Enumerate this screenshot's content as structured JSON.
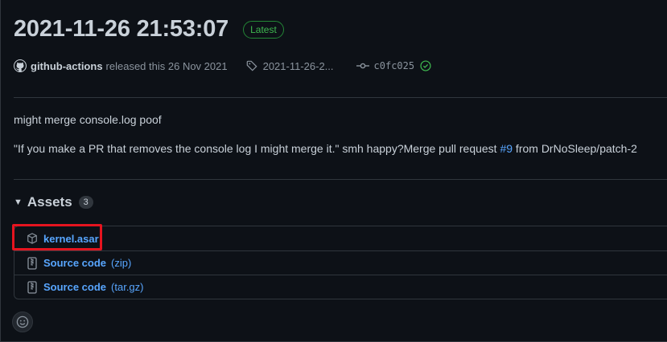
{
  "release": {
    "title": "2021-11-26 21:53:07",
    "badge": "Latest",
    "author": "github-actions",
    "released_text": "released this 26 Nov 2021",
    "tag": "2021-11-26-2...",
    "commit": "c0fc025"
  },
  "notes": {
    "line1": "might merge console.log poof",
    "line2_prefix": "\"If you make a PR that removes the console log I might merge it.\" smh happy?Merge pull request ",
    "line2_link": "#9",
    "line2_suffix": " from DrNoSleep/patch-2"
  },
  "assets": {
    "title": "Assets",
    "count": "3",
    "items": [
      {
        "label": "kernel.asar",
        "sub": "",
        "icon": "package-icon"
      },
      {
        "label": "Source code",
        "sub": "(zip)",
        "icon": "file-zip-icon"
      },
      {
        "label": "Source code",
        "sub": "(tar.gz)",
        "icon": "file-zip-icon"
      }
    ]
  },
  "colors": {
    "background": "#0d1117",
    "link": "#58a6ff",
    "badge_green": "#3fb950",
    "highlight_red": "#e5141f"
  }
}
